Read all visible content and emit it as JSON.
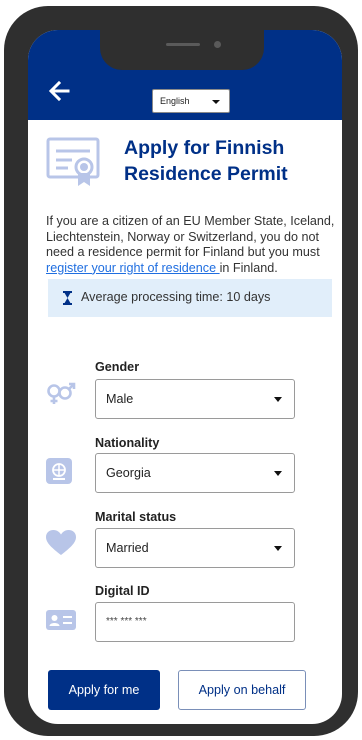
{
  "header": {
    "language": "English"
  },
  "page": {
    "title": "Apply for Finnish Residence Permit",
    "intro_before": "If you are a citizen of an EU Member State, Iceland, Liechtenstein, Norway or Switzerland, you do not need a residence permit for Finland but you must ",
    "intro_link": "register your right of residence ",
    "intro_after": "in Finland.",
    "processing_time": "Average processing time: 10 days"
  },
  "form": {
    "gender": {
      "label": "Gender",
      "value": "Male",
      "icon": "gender-icon"
    },
    "nationality": {
      "label": "Nationality",
      "value": "Georgia",
      "icon": "passport-icon"
    },
    "marital_status": {
      "label": "Marital status",
      "value": "Married",
      "icon": "heart-icon"
    },
    "digital_id": {
      "label": "Digital ID",
      "placeholder": "*** *** ***",
      "icon": "id-card-icon"
    }
  },
  "actions": {
    "apply_for_me": "Apply for me",
    "apply_on_behalf": "Apply on behalf"
  },
  "colors": {
    "brand_blue": "#003087",
    "icon_light_blue": "#b8c5e8",
    "info_bg": "#e1eefa",
    "link": "#1f6ee0"
  }
}
